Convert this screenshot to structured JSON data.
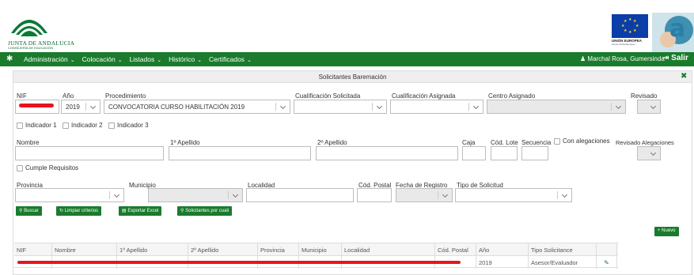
{
  "header": {
    "org_name": "JUNTA DE ANDALUCIA",
    "org_dept": "CONSEJERÍA DE EDUCACIÓN",
    "eu_label": "UNIÓN EUROPEA",
    "eu_sub": "Fondo Social Europeo",
    "brand_letter": "a"
  },
  "nav": {
    "items": [
      "Administración",
      "Colocación",
      "Listados",
      "Histórico",
      "Certificados"
    ],
    "user": "Marchal Rosa, Gumersinda",
    "exit": "Salir"
  },
  "panel": {
    "title": "Solicitantes Baremación"
  },
  "form": {
    "nif_label": "NIF",
    "anio_label": "Año",
    "anio_value": "2019",
    "procedimiento_label": "Procedimiento",
    "procedimiento_value": "CONVOCATORIA CURSO HABILITACIÓN 2019",
    "cual_solicitada_label": "Cualificación Solicitada",
    "cual_asignada_label": "Cualificación Asignada",
    "centro_label": "Centro Asignado",
    "revisado_label": "Revisado",
    "indicador1": "Indicador 1",
    "indicador2": "Indicador 2",
    "indicador3": "Indicador 3",
    "nombre_label": "Nombre",
    "apellido1_label": "1º Apellido",
    "apellido2_label": "2º Apellido",
    "caja_label": "Caja",
    "cod_lote_label": "Cód. Lote",
    "secuencia_label": "Secuencia",
    "con_alegaciones": "Con alegaciones",
    "revisado_alegaciones_label": "Revisado Alegaciones",
    "cumple_requisitos": "Cumple Requisitos",
    "provincia_label": "Provincia",
    "municipio_label": "Municipio",
    "localidad_label": "Localidad",
    "cod_postal_label": "Cód. Postal",
    "fecha_registro_label": "Fecha de Registro",
    "tipo_solicitud_label": "Tipo de Solicitud"
  },
  "buttons": {
    "buscar": "Buscar",
    "limpiar": "Limpiar criterios",
    "exportar": "Exportar Excel",
    "solicitantes": "Solicitantes por cuali",
    "nuevo": "+ Nuevo"
  },
  "table": {
    "headers": [
      "NIF",
      "Nombre",
      "1º Apellido",
      "2º Apellido",
      "Provincia",
      "Municipio",
      "Localidad",
      "Cód. Postal",
      "Año",
      "Tipo Solicitance",
      "",
      ""
    ],
    "rows": [
      [
        "",
        "",
        "",
        "",
        "",
        "",
        "",
        "",
        "2019",
        "Asesor/Evaluador",
        "",
        ""
      ]
    ]
  },
  "icons": {
    "home": "home-icon",
    "user": "user-icon",
    "exit": "sign-out-icon",
    "close": "close-icon",
    "search": "search-icon",
    "refresh": "refresh-icon",
    "excel": "excel-icon",
    "edit": "pencil-icon"
  },
  "colors": {
    "primary_green": "#1a7b2c",
    "redaction": "#e8141c",
    "eu_blue": "#0b3ea8"
  }
}
